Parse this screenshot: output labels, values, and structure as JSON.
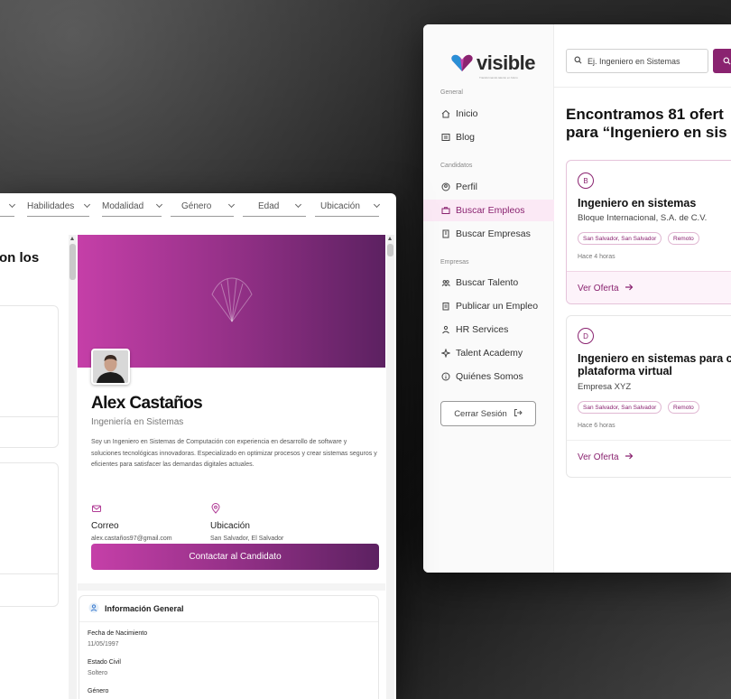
{
  "jobs_window": {
    "logo_text": "visible",
    "logo_tagline": "Transformando talento en futuro",
    "sections": {
      "general": "General",
      "candidatos": "Candidatos",
      "empresas": "Empresas"
    },
    "nav": {
      "inicio": "Inicio",
      "blog": "Blog",
      "perfil": "Perfil",
      "buscar_empleos": "Buscar Empleos",
      "buscar_empresas": "Buscar Empresas",
      "buscar_talento": "Buscar Talento",
      "publicar_empleo": "Publicar un Empleo",
      "hr_services": "HR Services",
      "talent_academy": "Talent Academy",
      "quienes_somos": "Quiénes Somos"
    },
    "logout_label": "Cerrar Sesión",
    "search_placeholder": "Ej. Ingeniero en Sistemas",
    "results_line1": "Encontramos 81 ofert",
    "results_line2": "para “Ingeniero en sis",
    "jobs": [
      {
        "badge": "B",
        "title": "Ingeniero en sistemas",
        "company": "Bloque Internacional, S.A. de C.V.",
        "location_tag": "San Salvador, San Salvador",
        "mode_tag": "Remoto",
        "time": "Hace 4 horas",
        "cta": "Ver Oferta"
      },
      {
        "badge": "D",
        "title_line1": "Ingeniero en sistemas para c",
        "title_line2": "plataforma virtual",
        "company": "Empresa XYZ",
        "location_tag": "San Salvador, San Salvador",
        "mode_tag": "Remoto",
        "time": "Hace 6 horas",
        "cta": "Ver Oferta"
      }
    ]
  },
  "profile_window": {
    "filters": {
      "habilidades": "Habilidades",
      "modalidad": "Modalidad",
      "genero": "Género",
      "edad": "Edad",
      "ubicacion": "Ubicación"
    },
    "left_heading": "on los",
    "candidate": {
      "name": "Alex Castaños",
      "role": "Ingeniería en Sistemas",
      "bio": "Soy un Ingeniero en Sistemas de Computación con experiencia en desarrollo de software y soluciones tecnológicas innovadoras. Especializado en optimizar procesos y crear sistemas seguros y eficientes para satisfacer las demandas digitales actuales.",
      "email_label": "Correo",
      "email": "alex.castaños97@gmail.com",
      "location_label": "Ubicación",
      "location": "San Salvador, El Salvador",
      "contact_button": "Contactar al Candidato"
    },
    "info": {
      "title": "Información General",
      "birth_label": "Fecha de Nacimiento",
      "birth_value": "11/05/1997",
      "civil_label": "Estado Civil",
      "civil_value": "Soltero",
      "gender_label": "Género"
    }
  },
  "colors": {
    "brand": "#8a2370",
    "brand_gradient_start": "#c53fa8",
    "brand_gradient_end": "#5c2161"
  }
}
